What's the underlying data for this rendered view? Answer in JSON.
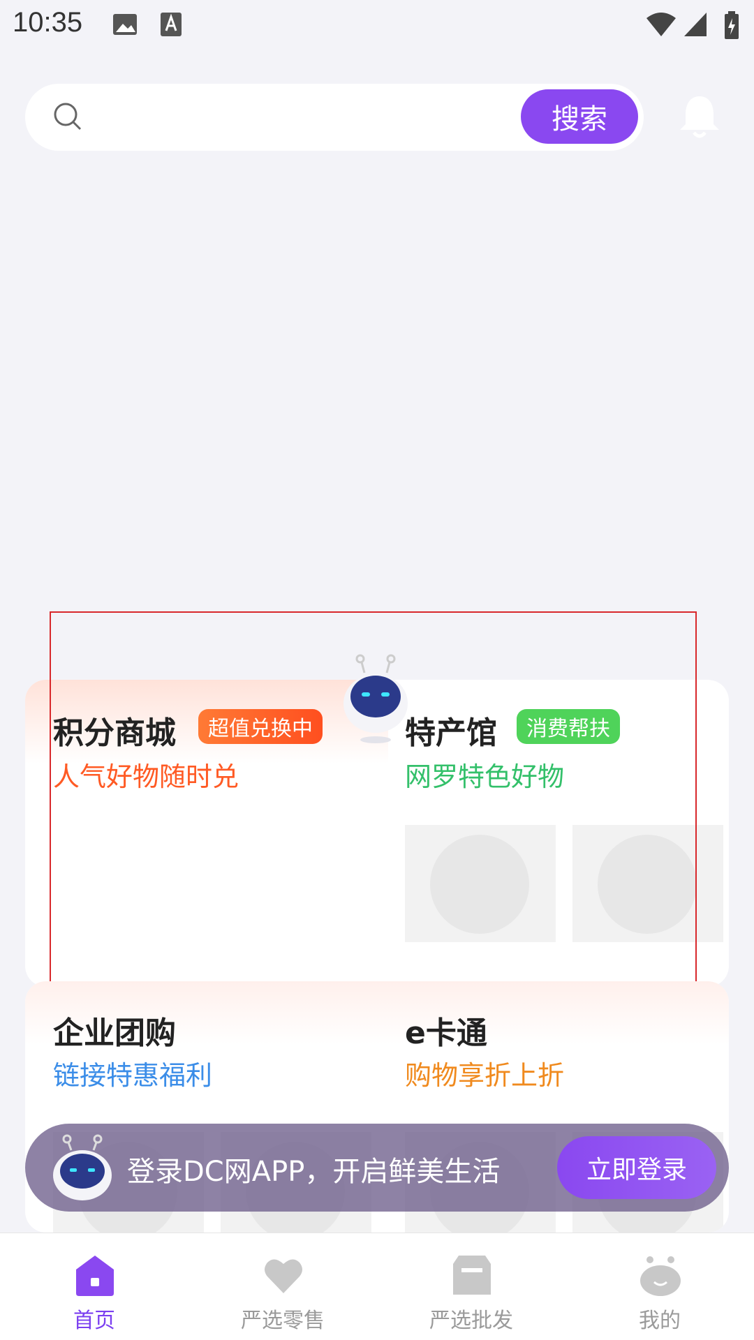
{
  "status_bar": {
    "time": "10:35"
  },
  "search": {
    "placeholder": "",
    "button_label": "搜索"
  },
  "features": {
    "points_mall": {
      "title": "积分商城",
      "tag": "超值兑换中",
      "subtitle": "人气好物随时兑",
      "tag_color": "#ff5a24",
      "subtitle_color": "#ff5a24"
    },
    "specialty": {
      "title": "特产馆",
      "tag": "消费帮扶",
      "subtitle": "网罗特色好物",
      "tag_color": "#4fd35a",
      "subtitle_color": "#33c06a"
    },
    "group_buy": {
      "title": "企业团购",
      "subtitle": "链接特惠福利",
      "subtitle_color": "#3b8de8"
    },
    "ecard": {
      "title": "e卡通",
      "subtitle": "购物享折上折",
      "subtitle_color": "#f08a1e"
    }
  },
  "login_banner": {
    "text": "登录DC网APP，开启鲜美生活",
    "button_label": "立即登录"
  },
  "bottom_nav": [
    {
      "label": "首页",
      "icon": "home-icon",
      "active": true
    },
    {
      "label": "严选零售",
      "icon": "heart-icon",
      "active": false
    },
    {
      "label": "严选批发",
      "icon": "box-icon",
      "active": false
    },
    {
      "label": "我的",
      "icon": "profile-icon",
      "active": false
    }
  ],
  "colors": {
    "accent": "#8a48f0"
  }
}
